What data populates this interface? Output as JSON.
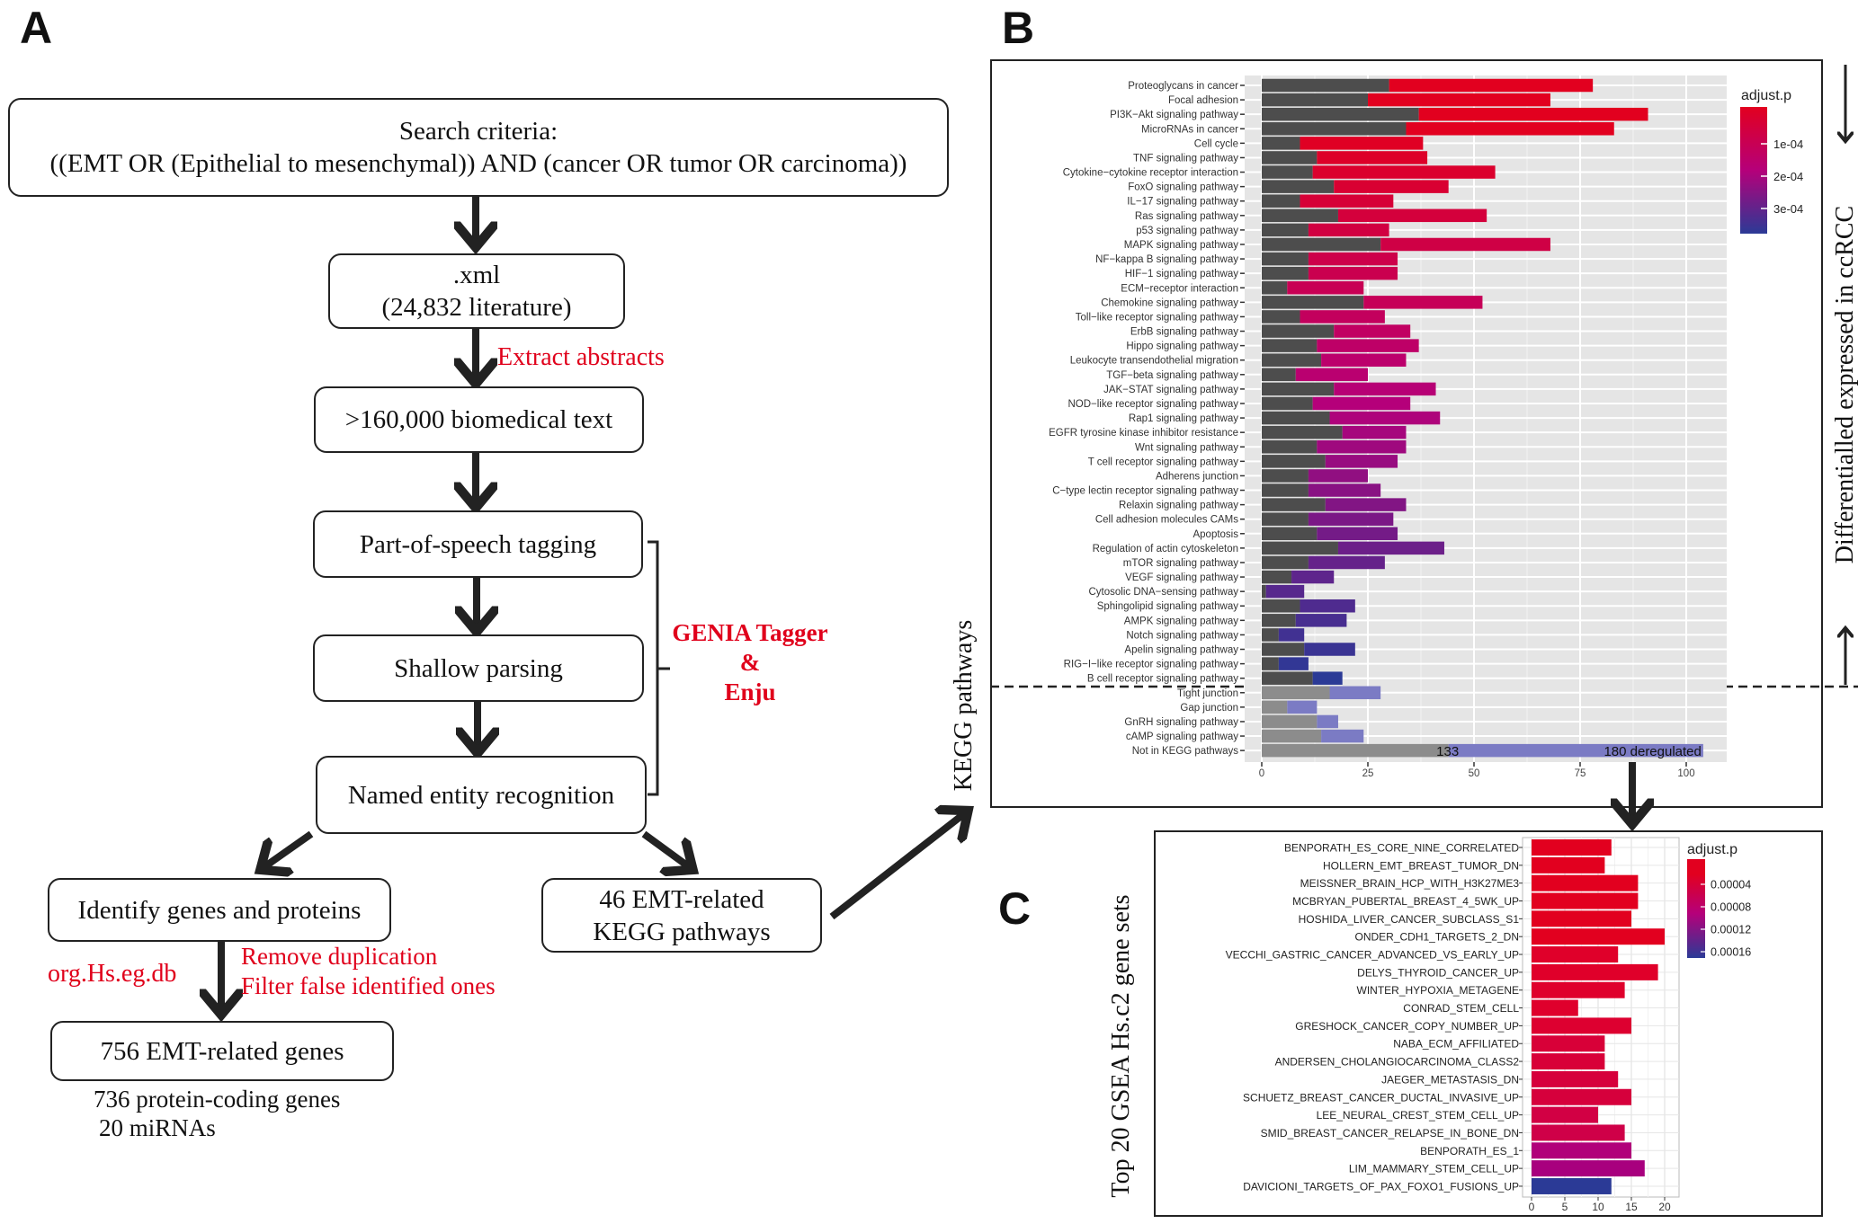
{
  "panel_labels": {
    "a": "A",
    "b": "B",
    "c": "C"
  },
  "flowchart": {
    "search_title": "Search criteria:",
    "search_query": "((EMT OR (Epithelial to mesenchymal)) AND (cancer OR tumor OR carcinoma))",
    "xml_line1": ".xml",
    "xml_line2": "(24,832 literature)",
    "extract_label": "Extract abstracts",
    "biomedical_text": ">160,000 biomedical text",
    "pos_tagging": "Part-of-speech tagging",
    "shallow_parsing": "Shallow parsing",
    "ner": "Named entity recognition",
    "tools": [
      "GENIA Tagger",
      "&",
      "Enju"
    ],
    "identify": "Identify genes and proteins",
    "kegg_line1": "46 EMT-related",
    "kegg_line2": "KEGG pathways",
    "org_db": "org.Hs.eg.db",
    "remove_dup": "Remove duplication",
    "filter_false": "Filter false identified ones",
    "genes_box": "756 EMT-related genes",
    "protein_coding": "736 protein-coding genes",
    "mirnas": "20  miRNAs"
  },
  "side_labels": {
    "kegg_pathways": "KEGG pathways",
    "differential": "Differentialled expressed in ccRCC",
    "gsea": "Top 20 GSEA Hs.c2 gene sets"
  },
  "colors": {
    "accent_red": "#e0001b",
    "high": "#e2001f",
    "mid": "#b5007a",
    "low": "#2b3a96",
    "outside_dark": "#8c8c8c",
    "outside_light": "#7b7bc4",
    "inside_dark": "#4d4d4d",
    "panel_bg": "#e5e5e5"
  },
  "chart_data": [
    {
      "type": "bar",
      "orientation": "horizontal-stacked",
      "categories": [
        "Proteoglycans in cancer",
        "Focal adhesion",
        "PI3K−Akt signaling pathway",
        "MicroRNAs in cancer",
        "Cell cycle",
        "TNF signaling pathway",
        "Cytokine−cytokine receptor interaction",
        "FoxO signaling pathway",
        "IL−17 signaling pathway",
        "Ras signaling pathway",
        "p53 signaling pathway",
        "MAPK signaling pathway",
        "NF−kappa B signaling pathway",
        "HIF−1 signaling pathway",
        "ECM−receptor interaction",
        "Chemokine signaling pathway",
        "Toll−like receptor signaling pathway",
        "ErbB signaling pathway",
        "Hippo signaling pathway",
        "Leukocyte transendothelial migration",
        "TGF−beta signaling pathway",
        "JAK−STAT signaling pathway",
        "NOD−like receptor signaling pathway",
        "Rap1 signaling pathway",
        "EGFR tyrosine kinase inhibitor resistance",
        "Wnt signaling pathway",
        "T cell receptor signaling pathway",
        "Adherens junction",
        "C−type lectin receptor signaling pathway",
        "Relaxin signaling pathway",
        "Cell adhesion molecules  CAMs ",
        "Apoptosis",
        "Regulation of actin cytoskeleton",
        "mTOR signaling pathway",
        "VEGF signaling pathway",
        "Cytosolic DNA−sensing pathway",
        "Sphingolipid signaling pathway",
        "AMPK signaling pathway",
        "Notch signaling pathway",
        "Apelin signaling pathway",
        "RIG−I−like receptor signaling pathway",
        "B cell receptor signaling pathway",
        "Tight junction",
        "Gap junction",
        "GnRH signaling pathway",
        "cAMP signaling pathway",
        "Not in KEGG pathways"
      ],
      "series": [
        {
          "values": [
            30,
            25,
            37,
            34,
            9,
            13,
            12,
            17,
            9,
            18,
            11,
            28,
            11,
            11,
            6,
            24,
            9,
            17,
            13,
            14,
            8,
            17,
            12,
            16,
            19,
            13,
            15,
            11,
            11,
            15,
            11,
            13,
            18,
            11,
            7,
            1,
            9,
            8,
            4,
            10,
            4,
            12,
            16,
            6,
            13,
            14,
            44
          ]
        },
        {
          "values": [
            48,
            43,
            54,
            49,
            29,
            26,
            43,
            27,
            22,
            35,
            19,
            40,
            21,
            21,
            18,
            28,
            20,
            18,
            24,
            20,
            17,
            24,
            23,
            26,
            15,
            21,
            17,
            14,
            17,
            19,
            20,
            19,
            25,
            18,
            10,
            9,
            13,
            12,
            6,
            12,
            7,
            7,
            12,
            7,
            5,
            10,
            60
          ]
        }
      ],
      "annotations": [
        "133",
        "180 deregulated"
      ],
      "xticks": [
        "0",
        "25",
        "50",
        "75",
        "100"
      ],
      "xlim": [
        -4,
        110
      ],
      "grid": true,
      "legend": {
        "title": "adjust.p",
        "ticks": [
          "1e-04",
          "2e-04",
          "3e-04"
        ],
        "placement": "right"
      },
      "separator_after": "B cell receptor signaling pathway"
    },
    {
      "type": "bar",
      "orientation": "horizontal",
      "categories": [
        "BENPORATH_ES_CORE_NINE_CORRELATED",
        "HOLLERN_EMT_BREAST_TUMOR_DN",
        "MEISSNER_BRAIN_HCP_WITH_H3K27ME3",
        "MCBRYAN_PUBERTAL_BREAST_4_5WK_UP",
        "HOSHIDA_LIVER_CANCER_SUBCLASS_S1",
        "ONDER_CDH1_TARGETS_2_DN",
        "VECCHI_GASTRIC_CANCER_ADVANCED_VS_EARLY_UP",
        "DELYS_THYROID_CANCER_UP",
        "WINTER_HYPOXIA_METAGENE",
        "CONRAD_STEM_CELL",
        "GRESHOCK_CANCER_COPY_NUMBER_UP",
        "NABA_ECM_AFFILIATED",
        "ANDERSEN_CHOLANGIOCARCINOMA_CLASS2",
        "JAEGER_METASTASIS_DN",
        "SCHUETZ_BREAST_CANCER_DUCTAL_INVASIVE_UP",
        "LEE_NEURAL_CREST_STEM_CELL_UP",
        "SMID_BREAST_CANCER_RELAPSE_IN_BONE_DN",
        "BENPORATH_ES_1",
        "LIM_MAMMARY_STEM_CELL_UP",
        "DAVICIONI_TARGETS_OF_PAX_FOXO1_FUSIONS_UP"
      ],
      "values": [
        12,
        11,
        16,
        16,
        15,
        20,
        13,
        19,
        14,
        7,
        15,
        11,
        11,
        13,
        15,
        10,
        14,
        15,
        17,
        12
      ],
      "colors": [
        "#e2001f",
        "#e2001f",
        "#e2001f",
        "#e2001f",
        "#e2001f",
        "#e2001f",
        "#e0002a",
        "#e0002a",
        "#df002c",
        "#df002c",
        "#dd0030",
        "#d80038",
        "#d80038",
        "#d6003c",
        "#d6003c",
        "#d20044",
        "#cf0048",
        "#b1007a",
        "#a8007e",
        "#2b3a96"
      ],
      "xticks": [
        "0",
        "5",
        "10",
        "15",
        "20"
      ],
      "xlim": [
        0,
        21
      ],
      "grid": true,
      "legend": {
        "title": "adjust.p",
        "ticks": [
          "0.00004",
          "0.00008",
          "0.00012",
          "0.00016"
        ],
        "placement": "right"
      }
    }
  ]
}
